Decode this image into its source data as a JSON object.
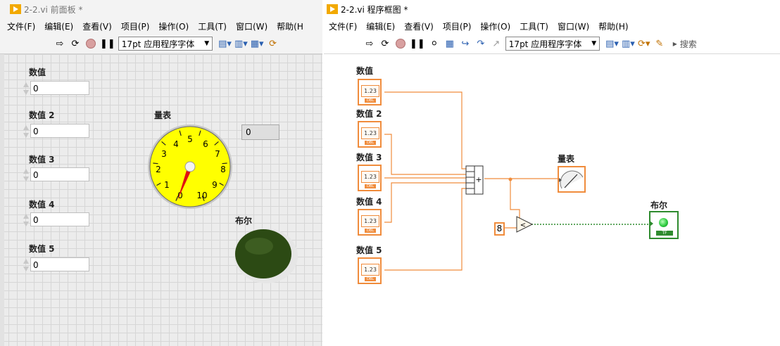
{
  "front_panel": {
    "title": "2-2.vi 前面板 *",
    "menus": [
      "文件(F)",
      "编辑(E)",
      "查看(V)",
      "项目(P)",
      "操作(O)",
      "工具(T)",
      "窗口(W)",
      "帮助(H"
    ],
    "font_selector": "17pt 应用程序字体",
    "controls": [
      {
        "label": "数值",
        "value": "0"
      },
      {
        "label": "数值 2",
        "value": "0"
      },
      {
        "label": "数值 3",
        "value": "0"
      },
      {
        "label": "数值 4",
        "value": "0"
      },
      {
        "label": "数值 5",
        "value": "0"
      }
    ],
    "gauge": {
      "label": "量表",
      "scale": [
        "0",
        "1",
        "2",
        "3",
        "4",
        "5",
        "6",
        "7",
        "8",
        "9",
        "10"
      ],
      "value": 0,
      "digital_display": "0"
    },
    "led": {
      "label": "布尔",
      "state": false
    }
  },
  "block_diagram": {
    "title": "2-2.vi 程序框图 *",
    "menus": [
      "文件(F)",
      "编辑(E)",
      "查看(V)",
      "项目(P)",
      "操作(O)",
      "工具(T)",
      "窗口(W)",
      "帮助(H)"
    ],
    "font_selector": "17pt 应用程序字体",
    "search_label": "搜索",
    "terminals": [
      {
        "label": "数值",
        "text": "1.23"
      },
      {
        "label": "数值 2",
        "text": "1.23"
      },
      {
        "label": "数值 3",
        "text": "1.23"
      },
      {
        "label": "数值 4",
        "text": "1.23"
      },
      {
        "label": "数值 5",
        "text": "1.23"
      }
    ],
    "gauge_terminal_label": "量表",
    "bool_terminal_label": "布尔",
    "constant": "8",
    "compare_symbol": "<",
    "add_symbol": "+",
    "dbl_tag": "DBL",
    "tf_tag": "TF"
  },
  "colors": {
    "numeric_wire": "#f08c3c",
    "boolean_wire": "#2e8b2e",
    "gauge_face": "#ffff00",
    "led_off": "#2c4a14"
  }
}
